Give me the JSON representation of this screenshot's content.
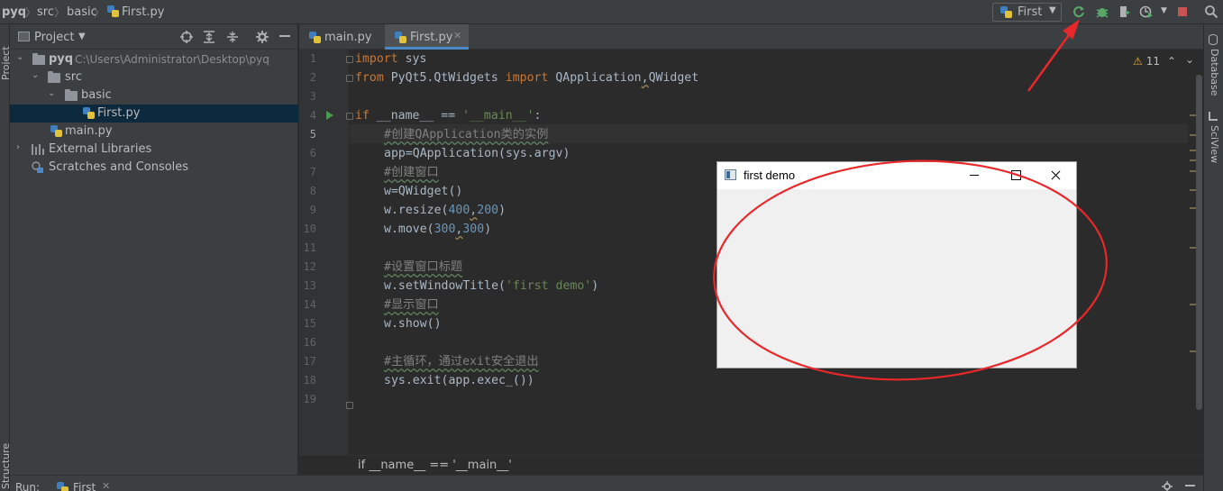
{
  "navbar": {
    "crumbs": [
      "pyq",
      "src",
      "basic",
      "First.py"
    ],
    "run_config": "First"
  },
  "left_strip": {
    "top_tab": "Project",
    "bottom_tab": "Structure"
  },
  "project": {
    "header_title": "Project",
    "tree": {
      "root": {
        "name": "pyq",
        "path": "C:\\Users\\Administrator\\Desktop\\pyq"
      },
      "src": "src",
      "basic": "basic",
      "first_file": "First.py",
      "main_file": "main.py",
      "external_libraries": "External Libraries",
      "scratches": "Scratches and Consoles"
    }
  },
  "editor": {
    "tabs": [
      {
        "label": "main.py"
      },
      {
        "label": "First.py"
      }
    ],
    "line_numbers": [
      "1",
      "2",
      "3",
      "4",
      "5",
      "6",
      "7",
      "8",
      "9",
      "10",
      "11",
      "12",
      "13",
      "14",
      "15",
      "16",
      "17",
      "18",
      "19"
    ],
    "code": {
      "l1_kw": "import",
      "l1_rest": " sys",
      "l2_kw1": "from",
      "l2_mod": " PyQt5.QtWidgets ",
      "l2_kw2": "import",
      "l2_names1": " QApplication",
      "l2_comma": ",",
      "l2_names2": "QWidget",
      "l4_kw": "if",
      "l4_mid": " __name__ == ",
      "l4_str": "'__main__'",
      "l4_end": ":",
      "l5_cmt": "#创建QApplication类的实例",
      "l6": "app=QApplication(sys.argv)",
      "l7_cmt": "#创建窗口",
      "l8": "w=QWidget()",
      "l9_pre": "w.resize(",
      "l9_n1": "400",
      "l9_comma": ",",
      "l9_n2": "200",
      "l9_post": ")",
      "l10_pre": "w.move(",
      "l10_n1": "300",
      "l10_comma": ",",
      "l10_n2": "300",
      "l10_post": ")",
      "l12_cmt": "#设置窗口标题",
      "l13_pre": "w.setWindowTitle(",
      "l13_str": "'first demo'",
      "l13_post": ")",
      "l14_cmt": "#显示窗口",
      "l15": "w.show()",
      "l17_cmt": "#主循环，通过exit安全退出",
      "l18": "sys.exit(app.exec_())"
    },
    "inspection_count": "11",
    "breadcrumb": "if __name__ == '__main__'"
  },
  "right_strip": {
    "tabs": [
      "Database",
      "SciView"
    ]
  },
  "run_bar": {
    "label": "Run:",
    "tab": "First"
  },
  "qt_window": {
    "title": "first demo"
  },
  "icons": {
    "rerun": "rerun-icon",
    "debug": "debug-icon",
    "coverage": "coverage-icon",
    "profile": "profile-icon",
    "stop": "stop-icon",
    "search": "search-icon"
  },
  "colors": {
    "annotation_red": "#e8282a",
    "run_green": "#499c54",
    "stop_red": "#c75450"
  }
}
